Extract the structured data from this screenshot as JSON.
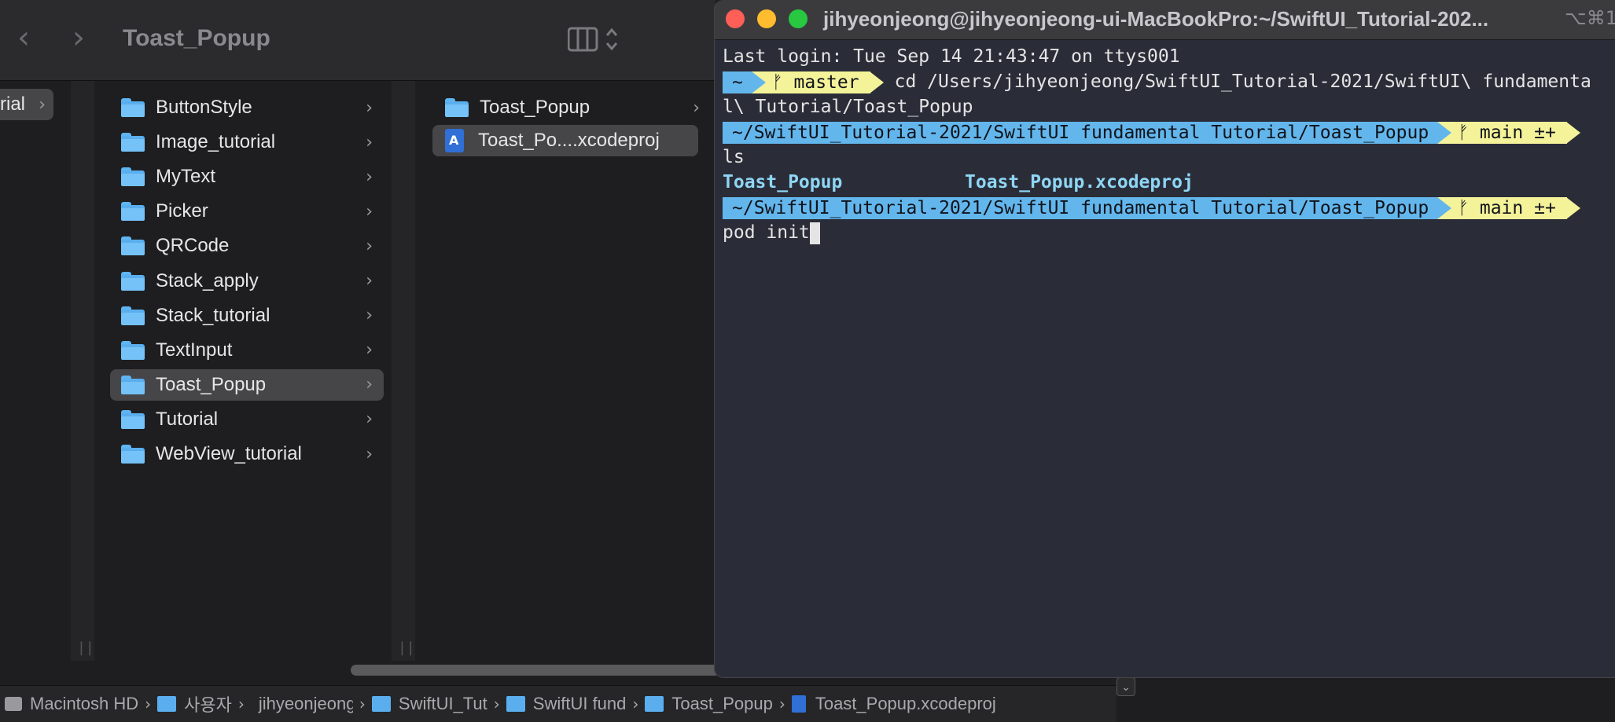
{
  "finder": {
    "title": "Toast_Popup",
    "col1_item": "rial",
    "folders": [
      "ButtonStyle",
      "Image_tutorial",
      "MyText",
      "Picker",
      "QRCode",
      "Stack_apply",
      "Stack_tutorial",
      "TextInput",
      "Toast_Popup",
      "Tutorial",
      "WebView_tutorial"
    ],
    "selected_folder": "Toast_Popup",
    "col3_items": [
      {
        "label": "Toast_Popup",
        "type": "folder"
      },
      {
        "label": "Toast_Po....xcodeproj",
        "type": "xcodeproj"
      }
    ],
    "path_bar": [
      "Macintosh HD",
      "사용자",
      "jihyeonjeong",
      "SwiftUI_Tut",
      "SwiftUI fund",
      "Toast_Popup",
      "Toast_Popup.xcodeproj"
    ]
  },
  "terminal": {
    "title": "jihyeonjeong@jihyeonjeong-ui-MacBookPro:~/SwiftUI_Tutorial-202...",
    "shortcut": "⌥⌘1",
    "last_login": "Last login: Tue Sep 14 21:43:47 on ttys001",
    "prompt1": {
      "dir": "~",
      "branch": "ᚠ master"
    },
    "cmd1_a": "cd /Users/jihyeonjeong/SwiftUI_Tutorial-2021/SwiftUI\\ fundamenta",
    "cmd1_b": "l\\ Tutorial/Toast_Popup",
    "prompt2": {
      "dir": "~/SwiftUI_Tutorial-2021/SwiftUI fundamental Tutorial/Toast_Popup",
      "branch": "ᚠ main ±+"
    },
    "cmd2": "ls",
    "ls_out1": "Toast_Popup",
    "ls_out2": "Toast_Popup.xcodeproj",
    "prompt3": {
      "dir": "~/SwiftUI_Tutorial-2021/SwiftUI fundamental Tutorial/Toast_Popup",
      "branch": "ᚠ main ±+"
    },
    "cmd3": "pod init"
  },
  "colors": {
    "accent_blue": "#63b6ec",
    "accent_yellow": "#f5f39a",
    "folder": "#5aaeee"
  }
}
